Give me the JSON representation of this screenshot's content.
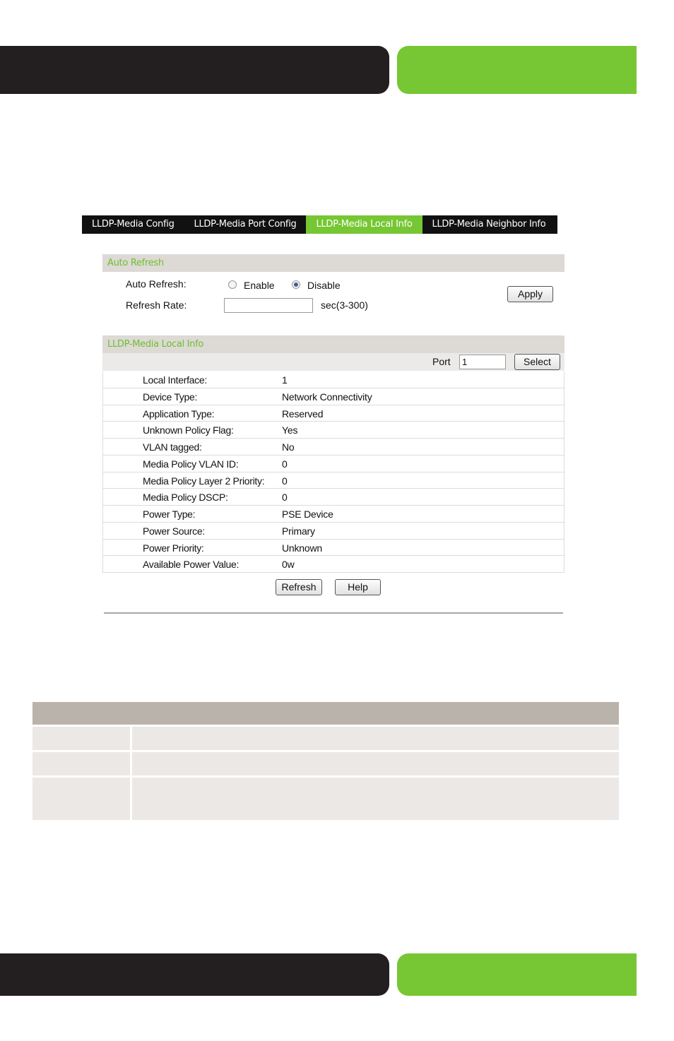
{
  "tabs": [
    {
      "label": "LLDP-Media Config",
      "active": false
    },
    {
      "label": "LLDP-Media Port Config",
      "active": false
    },
    {
      "label": "LLDP-Media Local Info",
      "active": true
    },
    {
      "label": "LLDP-Media Neighbor Info",
      "active": false
    }
  ],
  "auto_refresh": {
    "section_title": "Auto Refresh",
    "auto_refresh_label": "Auto Refresh:",
    "enable_label": "Enable",
    "disable_label": "Disable",
    "selected": "Disable",
    "refresh_rate_label": "Refresh Rate:",
    "refresh_rate_value": "",
    "refresh_rate_hint": "sec(3-300)",
    "apply_label": "Apply"
  },
  "local_info": {
    "section_title": "LLDP-Media Local Info",
    "port_label": "Port",
    "port_value": "1",
    "select_label": "Select",
    "rows": [
      {
        "key": "Local Interface:",
        "value": "1"
      },
      {
        "key": "Device Type:",
        "value": "Network Connectivity"
      },
      {
        "key": "Application Type:",
        "value": "Reserved"
      },
      {
        "key": "Unknown Policy Flag:",
        "value": "Yes"
      },
      {
        "key": "VLAN tagged:",
        "value": "No"
      },
      {
        "key": "Media Policy VLAN ID:",
        "value": "0"
      },
      {
        "key": "Media Policy Layer 2 Priority:",
        "value": "0"
      },
      {
        "key": "Media Policy DSCP:",
        "value": "0"
      },
      {
        "key": "Power Type:",
        "value": "PSE Device"
      },
      {
        "key": "Power Source:",
        "value": "Primary"
      },
      {
        "key": "Power Priority:",
        "value": "Unknown"
      },
      {
        "key": "Available Power Value:",
        "value": "0w"
      }
    ],
    "refresh_label": "Refresh",
    "help_label": "Help"
  },
  "colors": {
    "brand_green": "#76c733",
    "band_dark": "#231f20",
    "section_title_green": "#6fbf2f"
  }
}
